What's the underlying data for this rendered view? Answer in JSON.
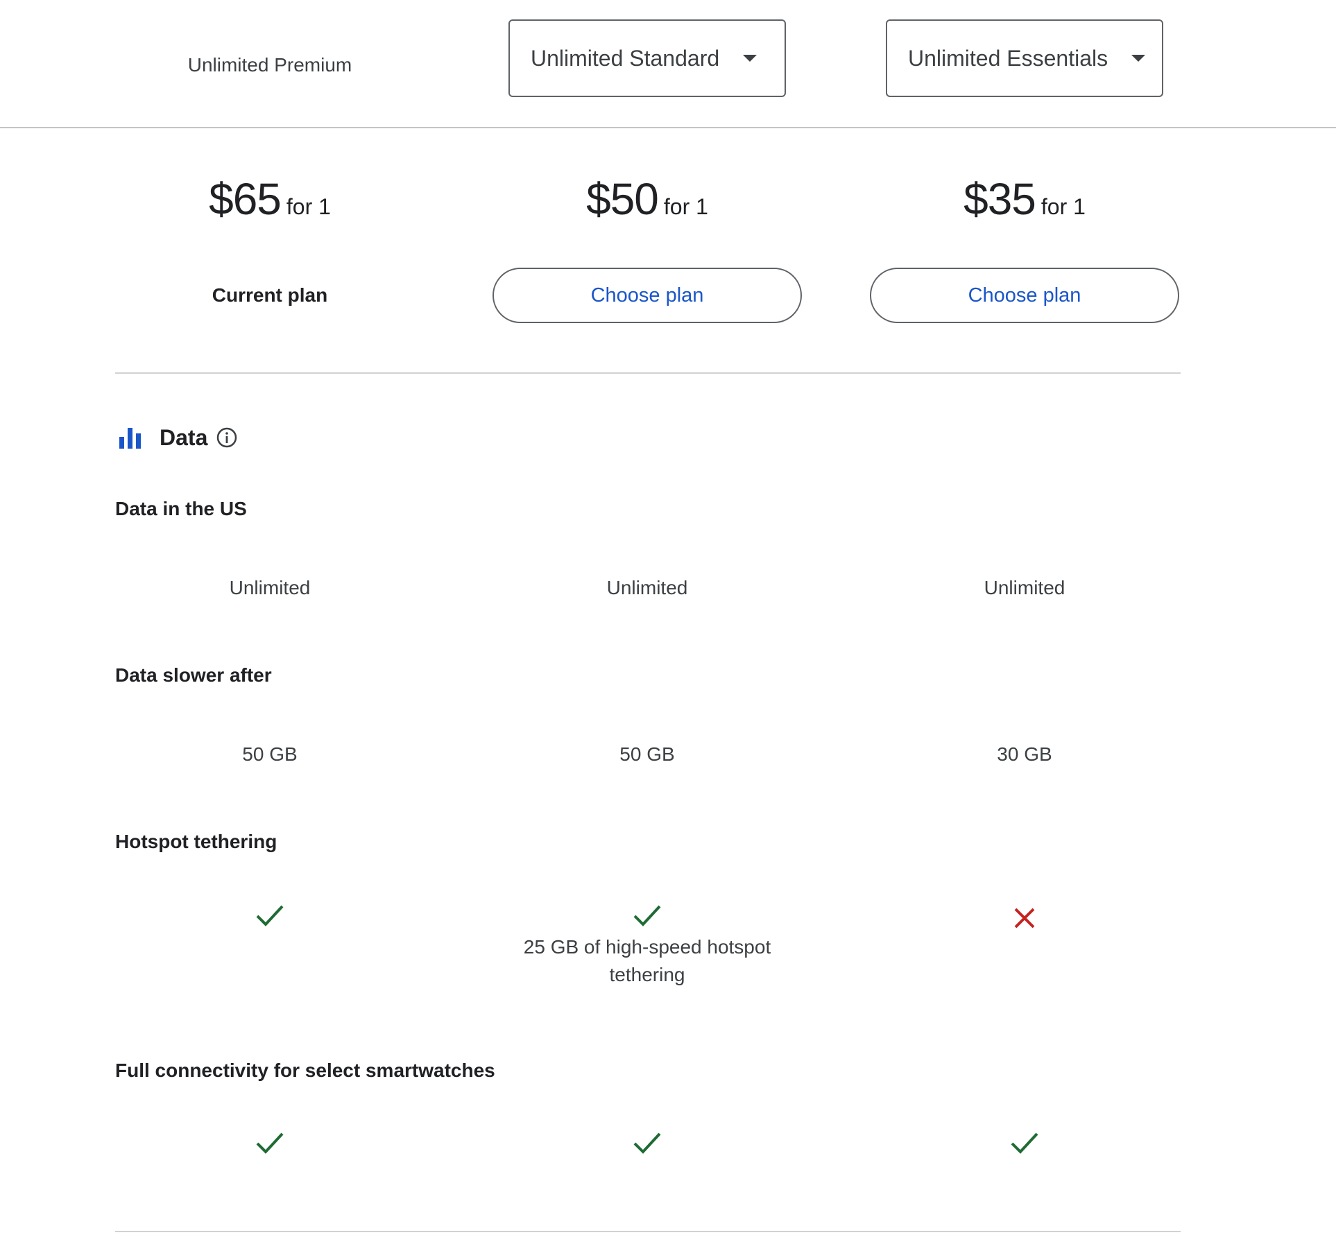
{
  "header": {
    "plans": [
      {
        "label": "Unlimited Premium",
        "type": "static"
      },
      {
        "label": "Unlimited Standard",
        "type": "select"
      },
      {
        "label": "Unlimited Essentials",
        "type": "select"
      }
    ]
  },
  "pricing": [
    {
      "amount": "$65",
      "suffix": "for 1"
    },
    {
      "amount": "$50",
      "suffix": "for 1"
    },
    {
      "amount": "$35",
      "suffix": "for 1"
    }
  ],
  "actions": {
    "current_plan_label": "Current plan",
    "choose_plan_label": "Choose plan"
  },
  "section": {
    "title": "Data",
    "icon": "bar-chart-icon",
    "info_icon": "info-icon",
    "accent_color": "#1a56c9"
  },
  "features": {
    "data_us": {
      "label": "Data in the US",
      "values": [
        "Unlimited",
        "Unlimited",
        "Unlimited"
      ]
    },
    "data_slower": {
      "label": "Data slower after",
      "values": [
        "50 GB",
        "50 GB",
        "30 GB"
      ]
    },
    "hotspot": {
      "label": "Hotspot tethering",
      "values": [
        "check",
        "check",
        "cross"
      ],
      "notes": [
        "",
        "25 GB of high-speed hotspot tethering",
        ""
      ]
    },
    "smartwatch": {
      "label": "Full connectivity for select smartwatches",
      "values": [
        "check",
        "check",
        "check"
      ]
    }
  },
  "colors": {
    "check": "#1e6b34",
    "cross": "#c5221f",
    "link": "#1a56c9"
  }
}
